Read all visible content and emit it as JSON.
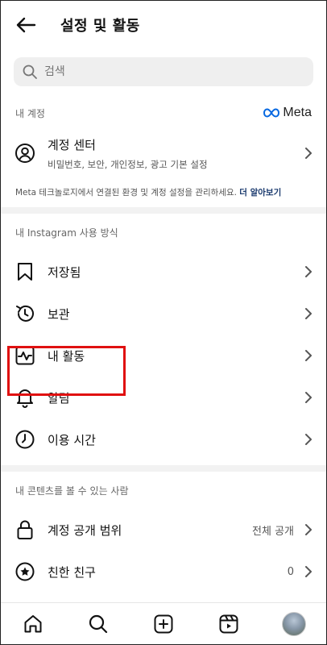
{
  "header": {
    "title": "설정 및 활동"
  },
  "search": {
    "placeholder": "검색"
  },
  "account_section": {
    "label": "내 계정",
    "brand": "Meta",
    "account_center": {
      "title": "계정 센터",
      "subtitle": "비밀번호, 보안, 개인정보, 광고 기본 설정"
    },
    "note": "Meta 테크놀로지에서 연결된 환경 및 계정 설정을 관리하세요.",
    "note_link": "더 알아보기"
  },
  "usage_section": {
    "label": "내 Instagram 사용 방식",
    "items": [
      {
        "label": "저장됨",
        "icon": "bookmark-icon"
      },
      {
        "label": "보관",
        "icon": "archive-history-icon"
      },
      {
        "label": "내 활동",
        "icon": "activity-icon"
      },
      {
        "label": "알림",
        "icon": "bell-icon"
      },
      {
        "label": "이용 시간",
        "icon": "clock-icon"
      }
    ]
  },
  "audience_section": {
    "label": "내 콘텐츠를 볼 수 있는 사람",
    "items": [
      {
        "label": "계정 공개 범위",
        "value": "전체 공개",
        "icon": "lock-icon"
      },
      {
        "label": "친한 친구",
        "value": "0",
        "icon": "close-friends-star-icon"
      }
    ]
  },
  "colors": {
    "highlight": "#e01010",
    "link": "#1a3a6e",
    "meta_blue": "#0668e1"
  },
  "bottom_nav": [
    "home-icon",
    "search-icon",
    "create-plus-icon",
    "reels-icon",
    "profile-avatar"
  ]
}
